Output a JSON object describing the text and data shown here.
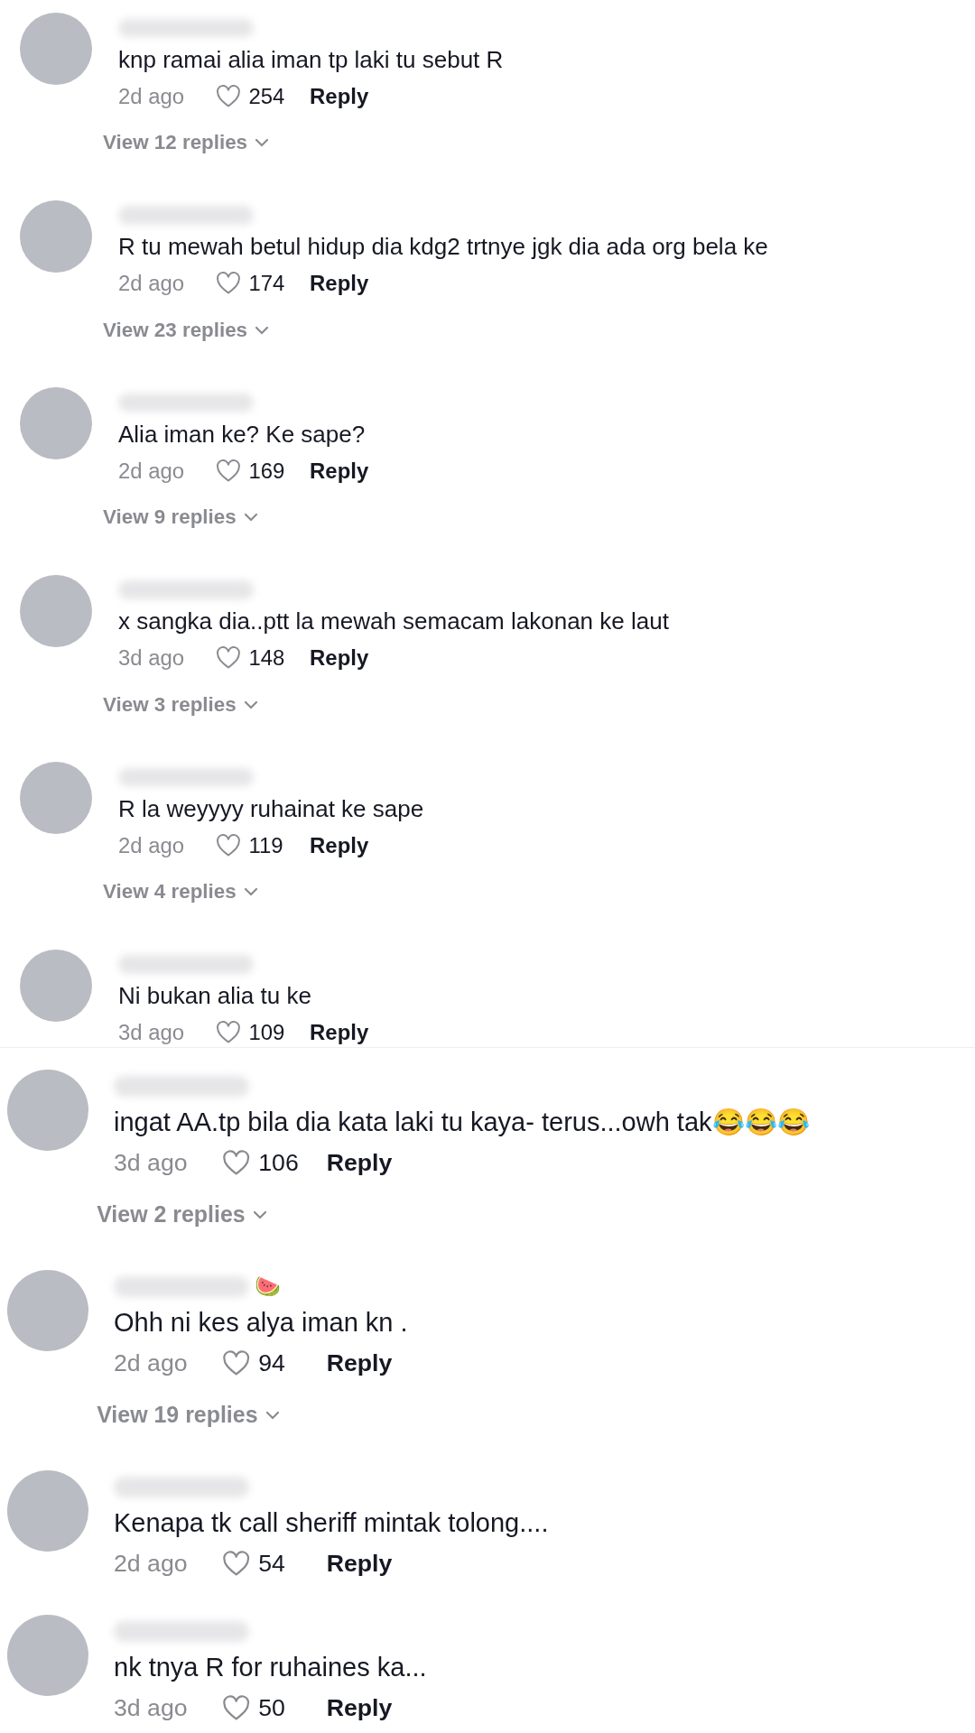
{
  "screens": [
    {
      "comments": [
        {
          "text": "knp ramai alia iman tp laki tu sebut R",
          "time": "2d ago",
          "likes": "254",
          "reply": "Reply",
          "view_replies": "View 12 replies"
        },
        {
          "text": "R tu mewah betul hidup dia kdg2 trtnye jgk dia ada org bela ke",
          "time": "2d ago",
          "likes": "174",
          "reply": "Reply",
          "view_replies": "View 23 replies"
        },
        {
          "text": "Alia iman ke? Ke sape?",
          "time": "2d ago",
          "likes": "169",
          "reply": "Reply",
          "view_replies": "View 9 replies"
        },
        {
          "text": "x sangka dia..ptt la mewah semacam lakonan ke laut",
          "time": "3d ago",
          "likes": "148",
          "reply": "Reply",
          "view_replies": "View 3 replies"
        },
        {
          "text": "R la weyyyy ruhainat ke sape",
          "time": "2d ago",
          "likes": "119",
          "reply": "Reply",
          "view_replies": "View 4 replies"
        },
        {
          "text": "Ni bukan alia tu ke",
          "time": "3d ago",
          "likes": "109",
          "reply": "Reply"
        }
      ]
    },
    {
      "comments": [
        {
          "text": "ingat AA.tp bila dia kata laki tu kaya- terus...owh tak😂😂😂",
          "time": "3d ago",
          "likes": "106",
          "reply": "Reply",
          "view_replies": "View 2 replies"
        },
        {
          "text": "Ohh ni kes alya iman kn .",
          "time": "2d ago",
          "likes": "94",
          "reply": "Reply",
          "view_replies": "View 19 replies",
          "badge": "🍉"
        },
        {
          "text": "Kenapa tk call sheriff mintak tolong....",
          "time": "2d ago",
          "likes": "54",
          "reply": "Reply"
        },
        {
          "text": "nk tnya R for ruhaines ka...",
          "time": "3d ago",
          "likes": "50",
          "reply": "Reply"
        }
      ]
    }
  ]
}
